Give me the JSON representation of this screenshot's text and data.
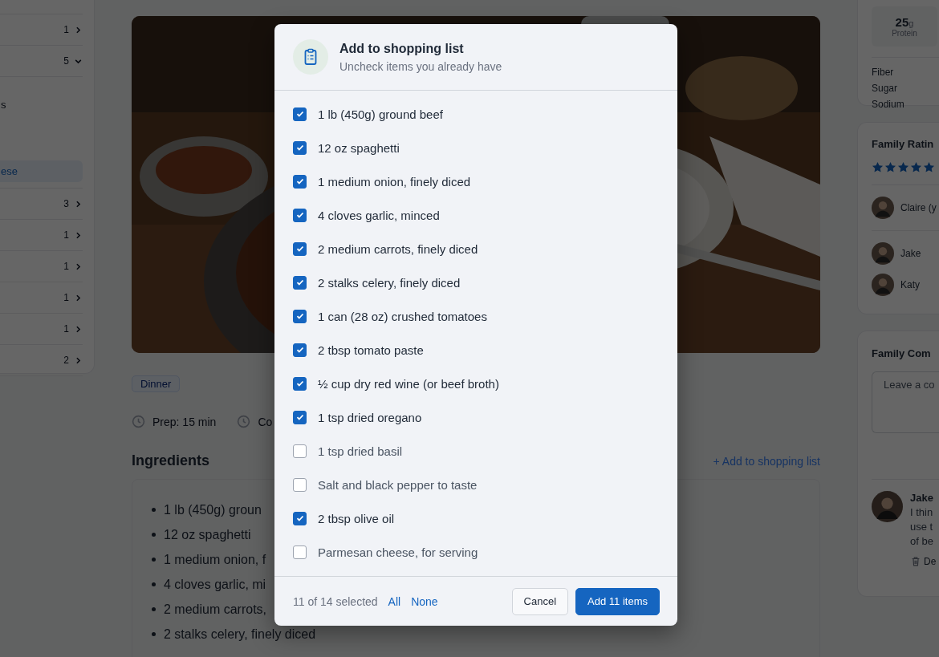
{
  "sidebar": {
    "items": [
      {
        "count": "1",
        "expanded": false
      },
      {
        "count": "5",
        "expanded": true,
        "children": [
          {
            "label": "s",
            "selected": false
          },
          {
            "label": "ese",
            "selected": true
          }
        ]
      },
      {
        "count": "3",
        "expanded": false
      },
      {
        "count": "1",
        "expanded": false
      },
      {
        "count": "1",
        "expanded": false
      },
      {
        "count": "1",
        "expanded": false
      },
      {
        "count": "1",
        "expanded": false
      },
      {
        "count": "2",
        "expanded": false
      }
    ]
  },
  "recipe": {
    "tag": "Dinner",
    "meta": [
      {
        "text": "Prep: 15 min"
      },
      {
        "text": "Co"
      }
    ],
    "ingredients": {
      "title": "Ingredients",
      "action": "+ Add to shopping list",
      "items": [
        "1 lb (450g) groun",
        "12 oz spaghetti",
        "1 medium onion, f",
        "4 cloves garlic, mi",
        "2 medium carrots,",
        "2 stalks celery, finely diced"
      ]
    }
  },
  "nutrition": {
    "highlight": {
      "value": "25",
      "unit": "g",
      "label": "Protein"
    },
    "rows": [
      "Fiber",
      "Sugar",
      "Sodium"
    ]
  },
  "ratings": {
    "title": "Family Ratin",
    "stars": 5,
    "raters": [
      {
        "name": "Claire (y"
      },
      {
        "name": "Jake"
      },
      {
        "name": "Katy"
      }
    ]
  },
  "comments": {
    "title": "Family Com",
    "placeholder": "Leave a co",
    "items": [
      {
        "author": "Jake",
        "lines": [
          "I thin",
          "use t",
          "of be"
        ],
        "delete": "De"
      }
    ]
  },
  "modal": {
    "title": "Add to shopping list",
    "subtitle": "Uncheck items you already have",
    "items": [
      {
        "label": "1 lb (450g) ground beef",
        "checked": true
      },
      {
        "label": "12 oz spaghetti",
        "checked": true
      },
      {
        "label": "1 medium onion, finely diced",
        "checked": true
      },
      {
        "label": "4 cloves garlic, minced",
        "checked": true
      },
      {
        "label": "2 medium carrots, finely diced",
        "checked": true
      },
      {
        "label": "2 stalks celery, finely diced",
        "checked": true
      },
      {
        "label": "1 can (28 oz) crushed tomatoes",
        "checked": true
      },
      {
        "label": "2 tbsp tomato paste",
        "checked": true
      },
      {
        "label": "½ cup dry red wine (or beef broth)",
        "checked": true
      },
      {
        "label": "1 tsp dried oregano",
        "checked": true
      },
      {
        "label": "1 tsp dried basil",
        "checked": false
      },
      {
        "label": "Salt and black pepper to taste",
        "checked": false
      },
      {
        "label": "2 tbsp olive oil",
        "checked": true
      },
      {
        "label": "Parmesan cheese, for serving",
        "checked": false
      }
    ],
    "summary": "11 of 14 selected",
    "select_all": "All",
    "select_none": "None",
    "cancel": "Cancel",
    "confirm": "Add 11 items"
  }
}
